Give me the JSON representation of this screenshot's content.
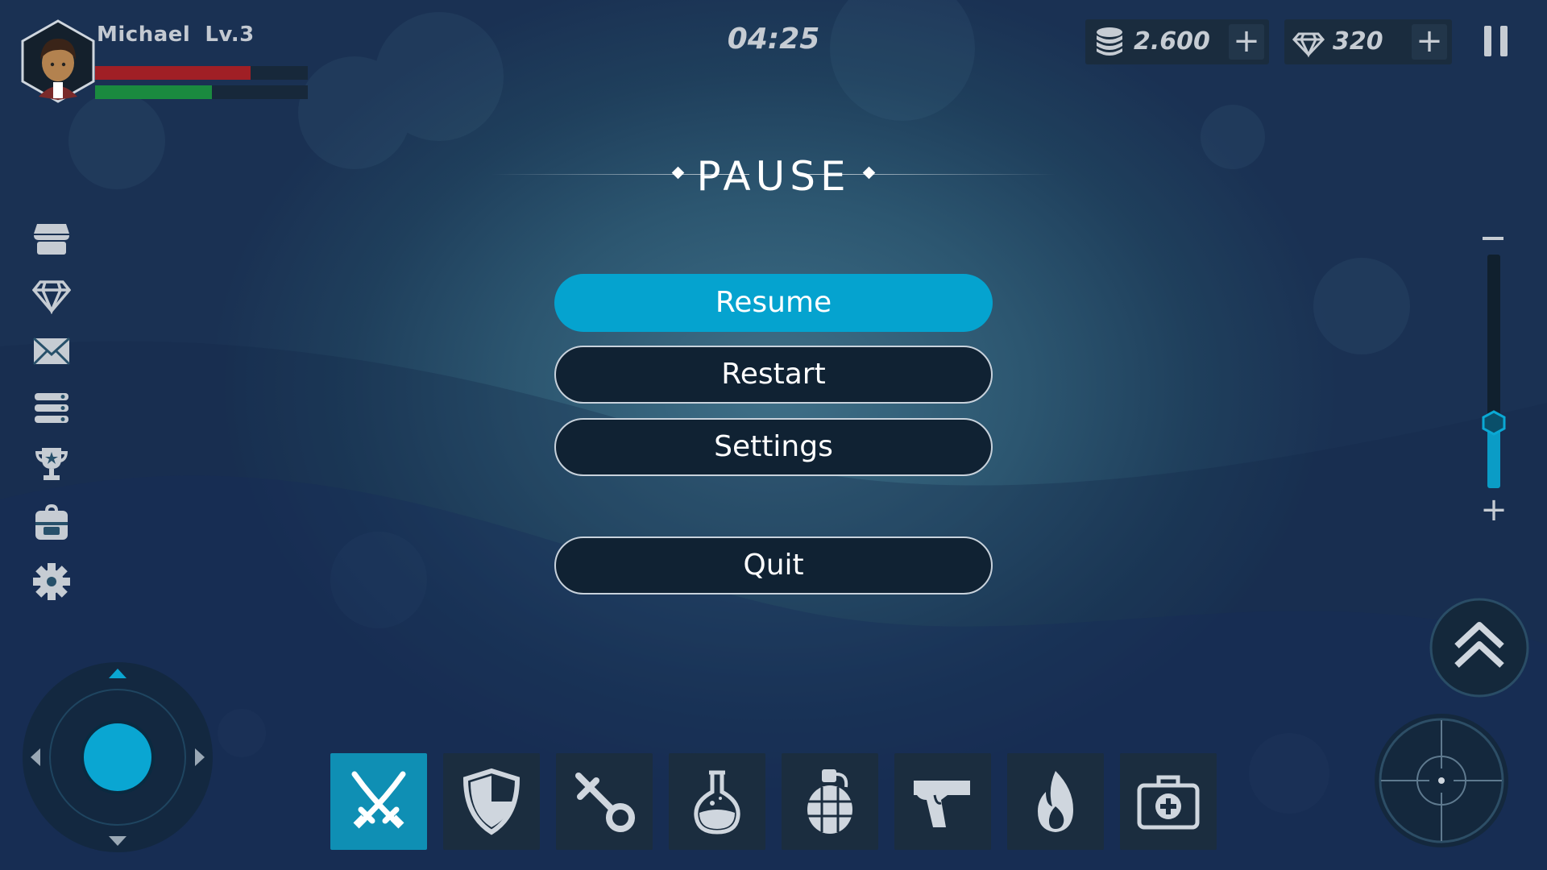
{
  "player": {
    "name": "Michael",
    "level": "Lv.3",
    "health_fraction": 0.73,
    "xp_fraction": 0.55
  },
  "timer": "04:25",
  "currency": {
    "coins": {
      "value": "2.600",
      "plus_label": "+"
    },
    "gems": {
      "value": "320",
      "plus_label": "+"
    }
  },
  "pause_menu": {
    "title": "PAUSE",
    "buttons": {
      "resume": "Resume",
      "restart": "Restart",
      "settings": "Settings",
      "quit": "Quit"
    }
  },
  "sidebar": {
    "items": [
      "shop-icon",
      "gem-icon",
      "mail-icon",
      "list-icon",
      "trophy-icon",
      "backpack-icon",
      "gear-icon"
    ]
  },
  "zoom": {
    "minus_label": "−",
    "plus_label": "+",
    "level_fraction": 0.28
  },
  "hotbar": {
    "slots": [
      "crossed-swords-icon",
      "shield-icon",
      "key-icon",
      "potion-icon",
      "grenade-icon",
      "pistol-icon",
      "fire-icon",
      "medkit-icon"
    ],
    "active_index": 0
  },
  "colors": {
    "accent": "#05a3cf",
    "health": "#a01f25",
    "xp": "#1a8a3f",
    "panel": "#102233"
  }
}
